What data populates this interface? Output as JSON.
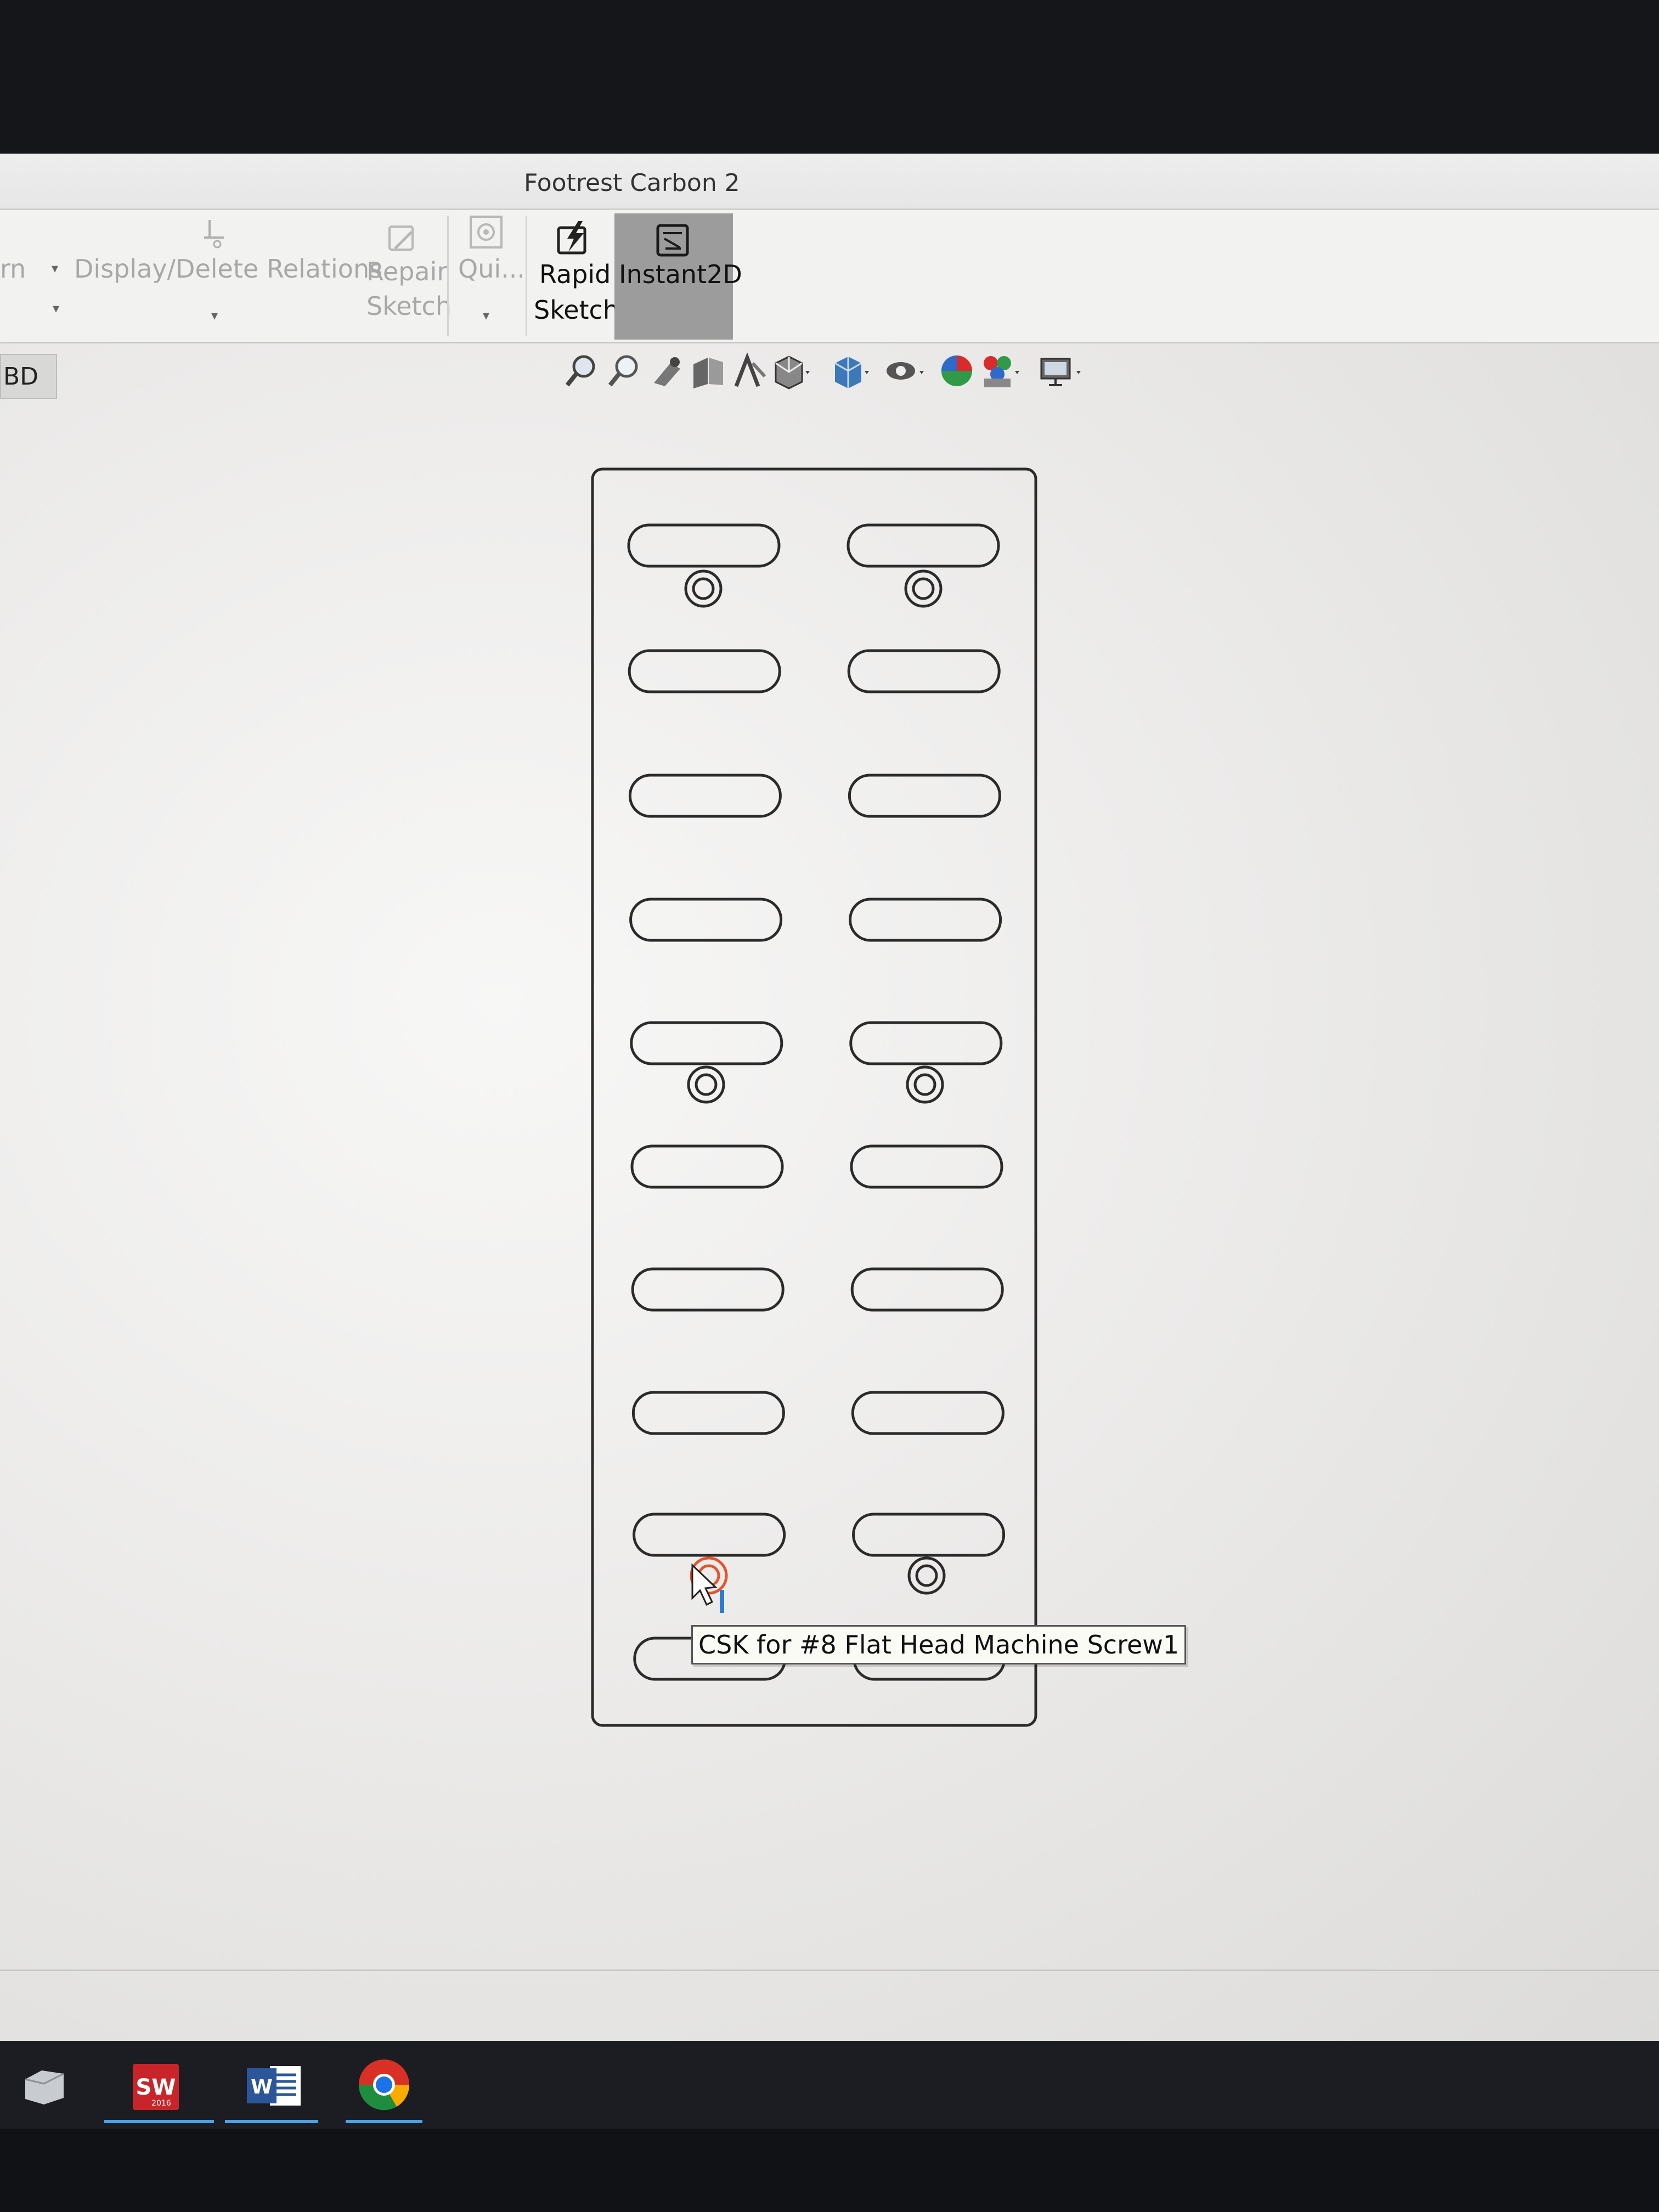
{
  "window": {
    "title": "Footrest Carbon 2"
  },
  "ribbon": {
    "partial_left": "rn",
    "display_delete_relations": "Display/Delete Relations",
    "repair_line1": "Repair",
    "repair_line2": "Sketch",
    "quick_snaps": "Qui...",
    "rapid_line1": "Rapid",
    "rapid_line2": "Sketch",
    "instant2d": "Instant2D"
  },
  "tree_tab": {
    "label": "BD"
  },
  "heads_up_toolbar": {
    "icons": [
      "zoom-to-fit-icon",
      "zoom-to-area-icon",
      "previous-view-icon",
      "section-view-icon",
      "dynamic-annotation-icon",
      "view-orientation-icon",
      "display-style-icon",
      "hide-show-items-icon",
      "edit-appearance-icon",
      "apply-scene-icon",
      "view-settings-icon"
    ]
  },
  "tooltip": {
    "text": "CSK for #8 Flat Head Machine Screw1"
  },
  "colors": {
    "screen_bg": "#ecebea",
    "sketch_line": "#2b2b2b",
    "highlight": "#e5532b",
    "instant2d_active": "#9c9c9c",
    "taskbar": "#1c1d22",
    "solidworks_red": "#c8252b",
    "word_blue": "#2b579a"
  },
  "taskbar": {
    "items": [
      {
        "name": "file-explorer",
        "active": false
      },
      {
        "name": "solidworks",
        "label": "SW",
        "sub": "2016",
        "active": true
      },
      {
        "name": "word",
        "label": "W",
        "active": true
      },
      {
        "name": "chrome",
        "active": true
      }
    ]
  }
}
